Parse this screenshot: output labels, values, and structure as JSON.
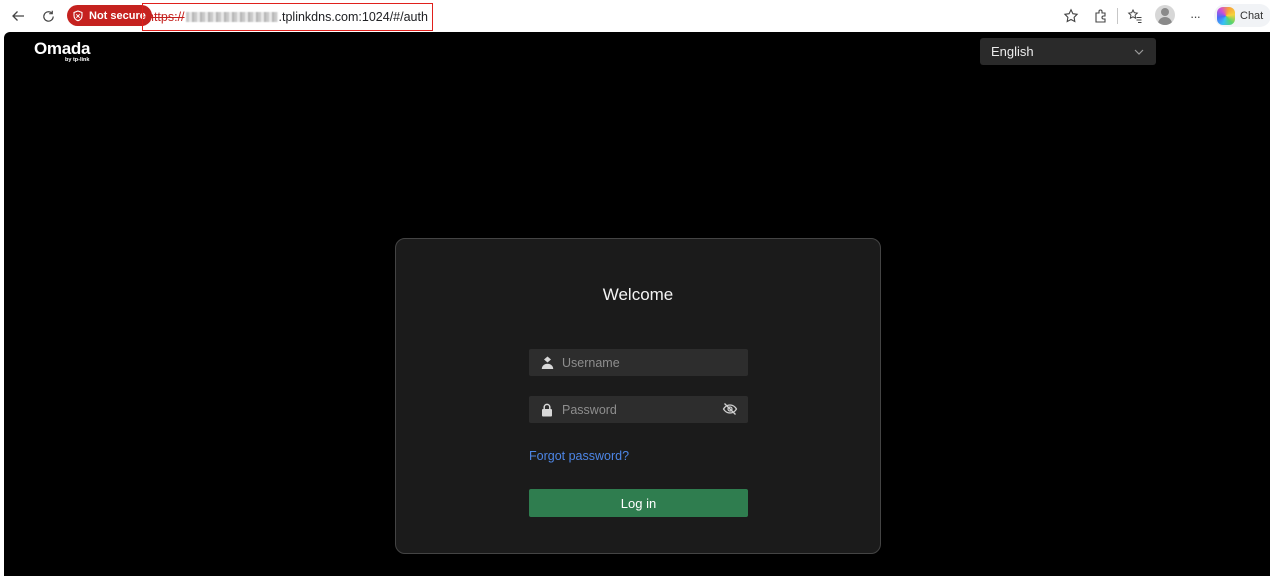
{
  "browser": {
    "security_label": "Not secure",
    "url_scheme": "https://",
    "url_host_suffix": ".tplinkdns.com:1024/#/auth",
    "chat_label": "Chat",
    "menu_glyph": "···"
  },
  "app": {
    "logo_text": "Omada",
    "logo_subtext": "by tp-link"
  },
  "language": {
    "selected": "English"
  },
  "login": {
    "title": "Welcome",
    "username_placeholder": "Username",
    "password_placeholder": "Password",
    "forgot_label": "Forgot password?",
    "submit_label": "Log in"
  },
  "colors": {
    "accent_green": "#2f7d4f",
    "link_blue": "#4d86e6",
    "danger_red": "#c5221f"
  },
  "icons": {
    "back": "arrow-left-icon",
    "reload": "reload-icon",
    "security": "shield-icon",
    "favorite": "star-icon",
    "extensions": "puzzle-icon",
    "favorites_list": "favorites-icon",
    "profile": "avatar-icon",
    "menu": "more-icon",
    "copilot": "copilot-icon",
    "username": "user-icon",
    "password": "lock-icon",
    "visibility": "eye-off-icon",
    "dropdown": "chevron-down-icon"
  }
}
